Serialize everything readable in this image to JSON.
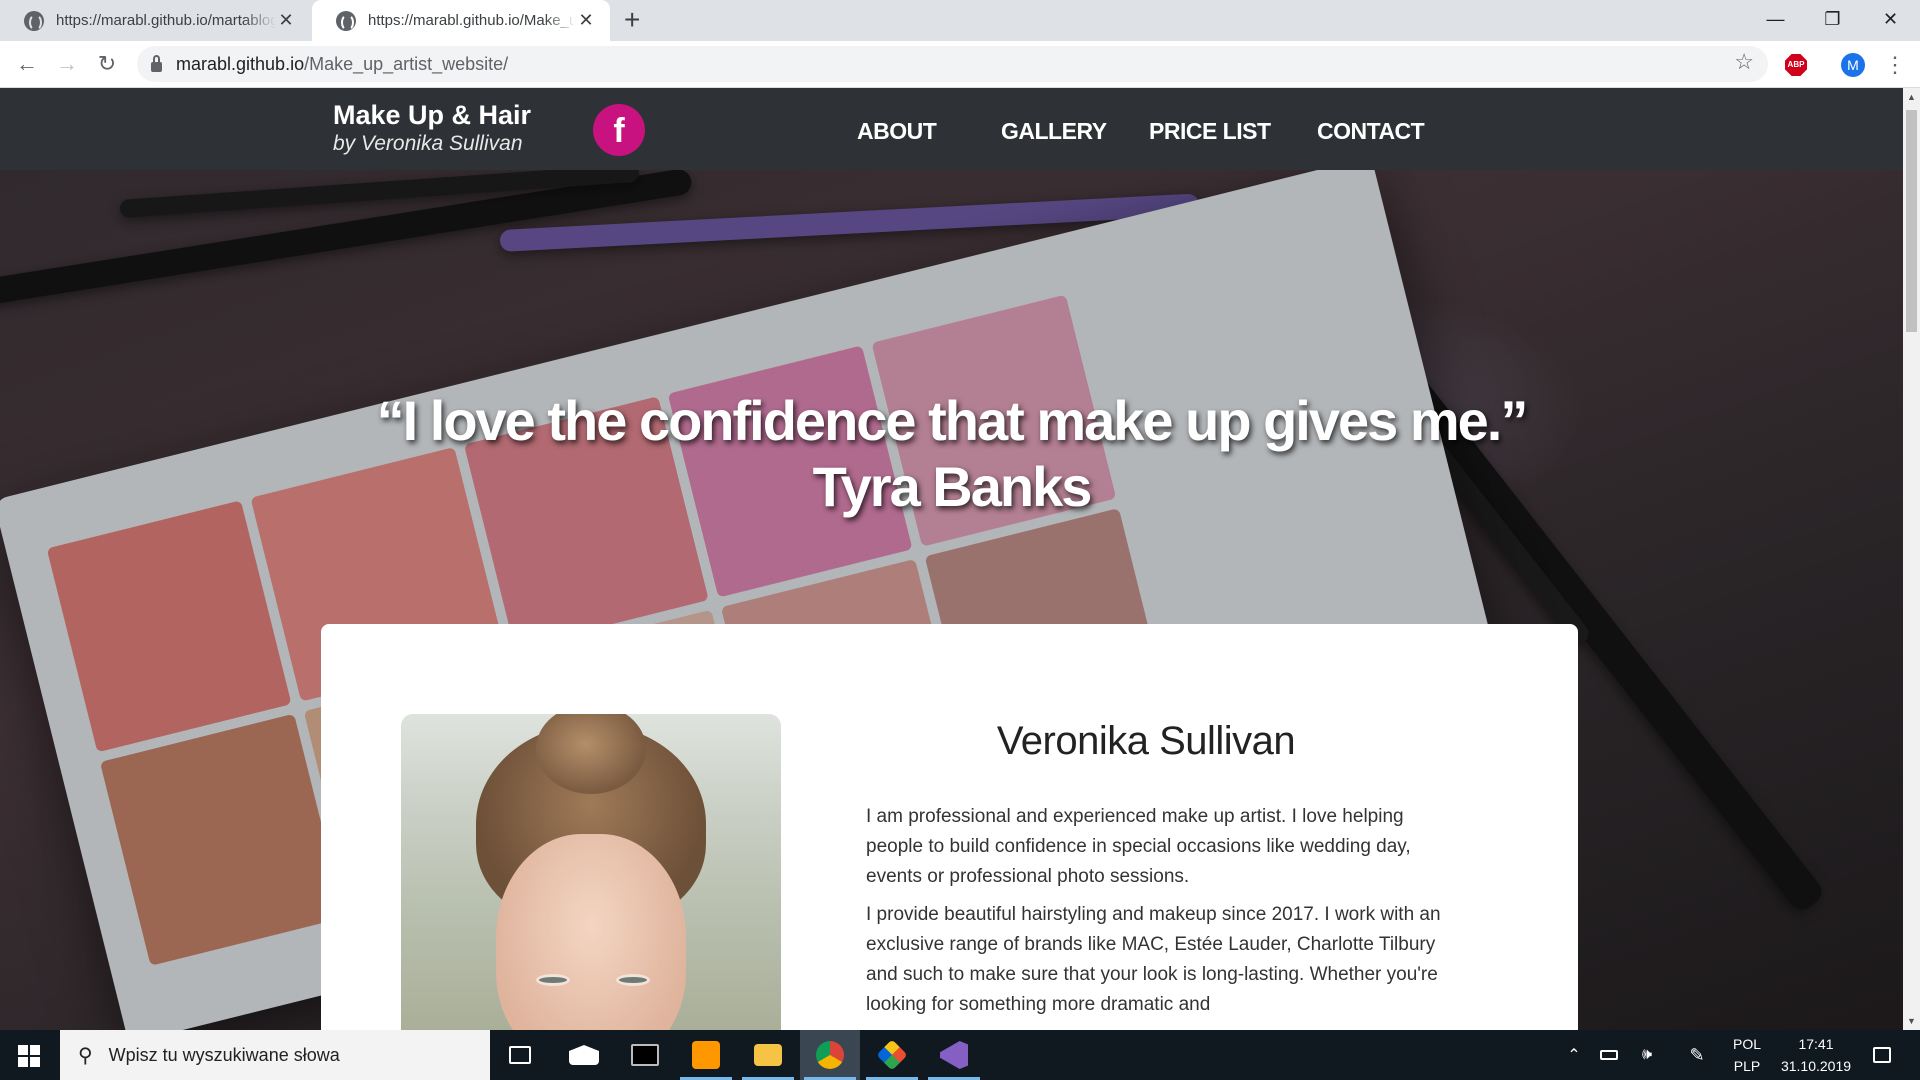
{
  "browser": {
    "tabs": [
      {
        "title": "https://marabl.github.io/martablog"
      },
      {
        "title": "https://marabl.github.io/Make_up_artist_website/"
      }
    ],
    "url_host": "marabl.github.io",
    "url_path": "/Make_up_artist_website/",
    "profile_initial": "M",
    "adblock_label": "ABP"
  },
  "site": {
    "brand_title": "Make Up & Hair",
    "brand_subtitle": "by Veronika Sullivan",
    "facebook_glyph": "f",
    "menu": [
      "ABOUT",
      "GALLERY",
      "PRICE LIST",
      "CONTACT"
    ],
    "quote_line1": "“I love the confidence that make up gives me.”",
    "quote_line2": "Tyra Banks",
    "about": {
      "name": "Veronika Sullivan",
      "paragraph1": "I am professional and experienced make up artist. I love helping people to build confidence in special occasions like wedding day, events or professional photo sessions.",
      "paragraph2": "I provide beautiful hairstyling and makeup since 2017. I work with an exclusive range of brands like MAC, Estée Lauder, Charlotte Tilbury and such to make sure that your look is long-lasting. Whether you're looking for something more dramatic and"
    },
    "colors": {
      "navbar": "#2e3236",
      "facebook": "#c7127f"
    }
  },
  "taskbar": {
    "search_placeholder": "Wpisz tu wyszukiwane słowa",
    "language_top": "POL",
    "language_bottom": "PLP",
    "time": "17:41",
    "date": "31.10.2019",
    "apps": [
      "task-view-icon",
      "mail-icon",
      "terminal-icon",
      "sublime-text-icon",
      "file-explorer-icon",
      "chrome-icon",
      "git-icon",
      "visual-studio-icon"
    ]
  }
}
